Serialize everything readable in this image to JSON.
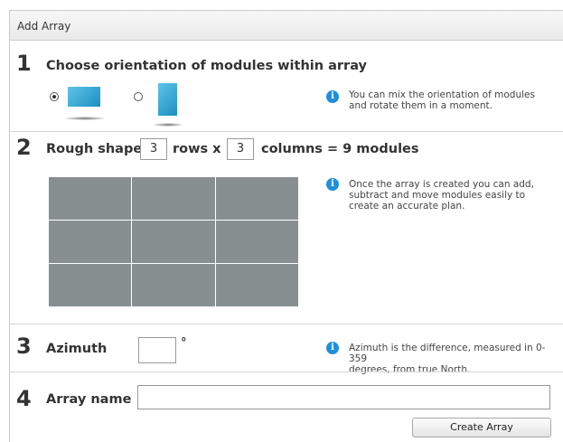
{
  "window": {
    "title": "Add Array"
  },
  "step1": {
    "number": "1",
    "title": "Choose orientation of modules within array",
    "options": [
      {
        "name": "landscape",
        "selected": true
      },
      {
        "name": "portrait",
        "selected": false
      }
    ],
    "info_icon": "info-icon",
    "info_line1": "You can mix the orientation of modules",
    "info_line2": "and rotate them in a moment."
  },
  "step2": {
    "number": "2",
    "label_prefix": "Rough shape",
    "rows": "3",
    "rows_label": "rows x",
    "columns": "3",
    "columns_label": "columns = 9 modules",
    "grid_rows": 3,
    "grid_columns": 3,
    "info_line1": "Once the array is created you can add,",
    "info_line2": "subtract and move modules easily to",
    "info_line3": "create an accurate plan."
  },
  "step3": {
    "number": "3",
    "label": "Azimuth",
    "value": "",
    "unit": "°",
    "info_line1": "Azimuth is the difference, measured in 0-359",
    "info_line2": "degrees, from true North."
  },
  "step4": {
    "number": "4",
    "label": "Array name",
    "value": ""
  },
  "actions": {
    "create_label": "Create Array"
  },
  "colors": {
    "accent": "#1f8fdc",
    "module": "#2aa3d3",
    "grid_cell": "#888f91"
  }
}
